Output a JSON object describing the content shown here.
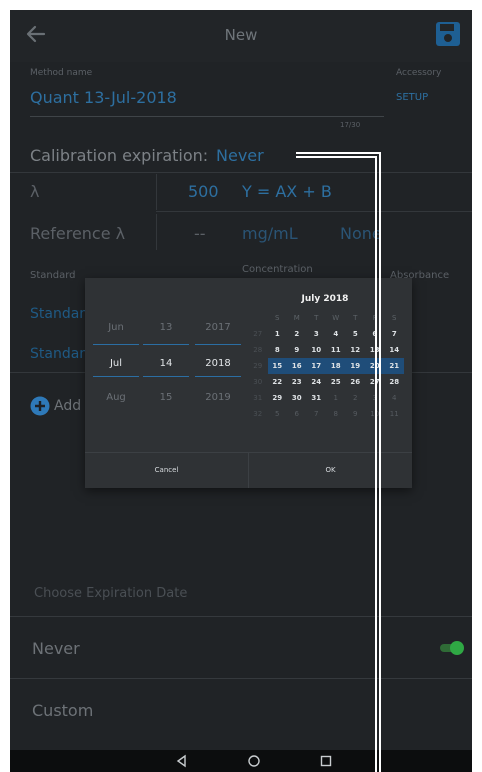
{
  "appbar": {
    "title": "New"
  },
  "method": {
    "label": "Method name",
    "value": "Quant 13-Jul-2018",
    "counter": "17/30"
  },
  "accessory": {
    "label": "Accessory",
    "value": "SETUP"
  },
  "calibration": {
    "label": "Calibration expiration:",
    "value": "Never"
  },
  "lambda": {
    "label": "λ",
    "value": "500",
    "equation": "Y = AX + B"
  },
  "reference": {
    "label": "Reference λ",
    "value": "--",
    "unit": "mg/mL",
    "extra": "None"
  },
  "table": {
    "col_standard": "Standard",
    "col_concentration": "Concentration",
    "col_absorbance": "Absorbance"
  },
  "standards": [
    "Standar",
    "Standar"
  ],
  "add_label": "Add",
  "date_picker": {
    "months": [
      "Jun",
      "Jul",
      "Aug"
    ],
    "days": [
      "13",
      "14",
      "15"
    ],
    "years": [
      "2017",
      "2018",
      "2019"
    ],
    "calendar_title": "July 2018",
    "weekdays": [
      "S",
      "M",
      "T",
      "W",
      "T",
      "F",
      "S"
    ],
    "weeks": [
      {
        "wk": "27",
        "days": [
          "1",
          "2",
          "3",
          "4",
          "5",
          "6",
          "7"
        ]
      },
      {
        "wk": "28",
        "days": [
          "8",
          "9",
          "10",
          "11",
          "12",
          "13",
          "14"
        ]
      },
      {
        "wk": "29",
        "days": [
          "15",
          "16",
          "17",
          "18",
          "19",
          "20",
          "21"
        ]
      },
      {
        "wk": "30",
        "days": [
          "22",
          "23",
          "24",
          "25",
          "26",
          "27",
          "28"
        ]
      },
      {
        "wk": "31",
        "days": [
          "29",
          "30",
          "31",
          "1",
          "2",
          "3",
          "4"
        ]
      },
      {
        "wk": "32",
        "days": [
          "5",
          "6",
          "7",
          "8",
          "9",
          "10",
          "11"
        ]
      }
    ],
    "cancel_label": "Cancel",
    "ok_label": "OK"
  },
  "sheet": {
    "title": "Choose Expiration Date",
    "options": [
      "Never",
      "Custom"
    ],
    "never_toggle_on": true
  },
  "colors": {
    "accent": "#2d6fa0",
    "toggle": "#2fa844",
    "background": "#202326"
  }
}
